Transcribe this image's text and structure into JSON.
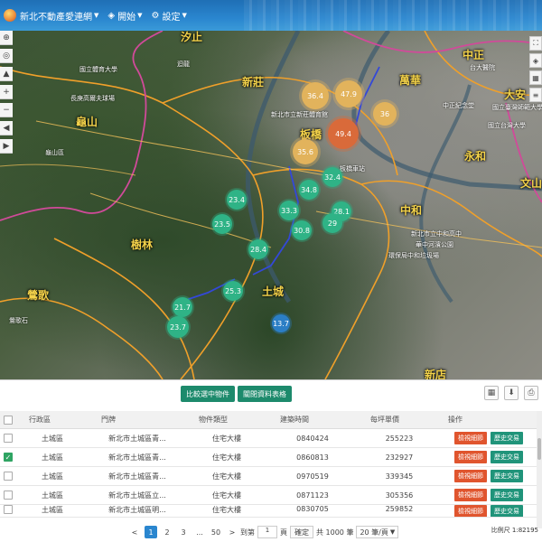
{
  "app": {
    "title": "新北不動產愛連網",
    "menu_start": "開始",
    "menu_settings": "設定"
  },
  "map": {
    "districts": [
      {
        "name": "汐止",
        "id": "xizhi"
      },
      {
        "name": "新莊",
        "id": "xinzhuang"
      },
      {
        "name": "萬華",
        "id": "wanhua"
      },
      {
        "name": "中正",
        "id": "zhongzheng"
      },
      {
        "name": "大安",
        "id": "daan"
      },
      {
        "name": "龜山",
        "id": "guishan"
      },
      {
        "name": "板橋",
        "id": "banqiao"
      },
      {
        "name": "永和",
        "id": "yonghe"
      },
      {
        "name": "中和",
        "id": "zhonghe"
      },
      {
        "name": "文山",
        "id": "wenshan"
      },
      {
        "name": "樹林",
        "id": "shulin"
      },
      {
        "name": "土城",
        "id": "tucheng"
      },
      {
        "name": "鶯歌",
        "id": "yingge"
      },
      {
        "name": "新店",
        "id": "xindian"
      }
    ],
    "places": [
      {
        "name": "國立體育大學",
        "id": "p1"
      },
      {
        "name": "長庚高爾夫球場",
        "id": "p2"
      },
      {
        "name": "迴龍",
        "id": "p3"
      },
      {
        "name": "新北市立新莊體育館",
        "id": "p4"
      },
      {
        "name": "板橋車站",
        "id": "p5"
      },
      {
        "name": "新北市立中和高中",
        "id": "p6"
      },
      {
        "name": "國立台灣大學",
        "id": "p7"
      },
      {
        "name": "華中河濱公園",
        "id": "p8"
      },
      {
        "name": "環保局中和垃圾場",
        "id": "p9"
      },
      {
        "name": "鶯歌石",
        "id": "p10"
      },
      {
        "name": "台大醫院",
        "id": "p11"
      },
      {
        "name": "國立臺灣師範大學",
        "id": "p12"
      },
      {
        "name": "龜山區",
        "id": "p13"
      },
      {
        "name": "中正紀念堂",
        "id": "p14"
      }
    ],
    "clusters": [
      {
        "value": "36.4",
        "color": "yellow"
      },
      {
        "value": "47.9",
        "color": "yellow"
      },
      {
        "value": "36",
        "color": "yellow"
      },
      {
        "value": "49.4",
        "color": "orange"
      },
      {
        "value": "35.6",
        "color": "yellow"
      },
      {
        "value": "32.4",
        "color": "green"
      },
      {
        "value": "34.8",
        "color": "green"
      },
      {
        "value": "23.4",
        "color": "green"
      },
      {
        "value": "28.1",
        "color": "green"
      },
      {
        "value": "33.3",
        "color": "green"
      },
      {
        "value": "29",
        "color": "green"
      },
      {
        "value": "23.5",
        "color": "green"
      },
      {
        "value": "30.8",
        "color": "green"
      },
      {
        "value": "28.4",
        "color": "green"
      },
      {
        "value": "25.3",
        "color": "green"
      },
      {
        "value": "21.7",
        "color": "green"
      },
      {
        "value": "23.7",
        "color": "green"
      },
      {
        "value": "13.7",
        "color": "blue"
      }
    ]
  },
  "panel": {
    "compare_button": "比較選中物件",
    "close_button": "關閉資料表格",
    "columns": [
      "行政區",
      "門牌",
      "物件類型",
      "建築時間",
      "每坪單價",
      "操作"
    ],
    "action_detail": "檢視細節",
    "action_history": "歷史交易",
    "rows": [
      {
        "district": "土城區",
        "address": "新北市土城區青...",
        "type": "住宅大樓",
        "built": "0840424",
        "price": "255223",
        "checked": false
      },
      {
        "district": "土城區",
        "address": "新北市土城區青...",
        "type": "住宅大樓",
        "built": "0860813",
        "price": "232927",
        "checked": true
      },
      {
        "district": "土城區",
        "address": "新北市土城區青...",
        "type": "住宅大樓",
        "built": "0970519",
        "price": "339345",
        "checked": false
      },
      {
        "district": "土城區",
        "address": "新北市土城區立...",
        "type": "住宅大樓",
        "built": "0871123",
        "price": "305356",
        "checked": false
      },
      {
        "district": "土城區",
        "address": "新北市土城區明...",
        "type": "住宅大樓",
        "built": "0830705",
        "price": "259852",
        "checked": false
      }
    ]
  },
  "pager": {
    "prev": "<",
    "pages": [
      "1",
      "2",
      "3",
      "...",
      "50"
    ],
    "next": ">",
    "goto_label": "到第",
    "goto_value": "1",
    "page_suffix": "頁",
    "confirm": "確定",
    "total": "共 1000 筆",
    "per_page": "20 筆/頁",
    "scale": "比例尺 1:82195"
  }
}
